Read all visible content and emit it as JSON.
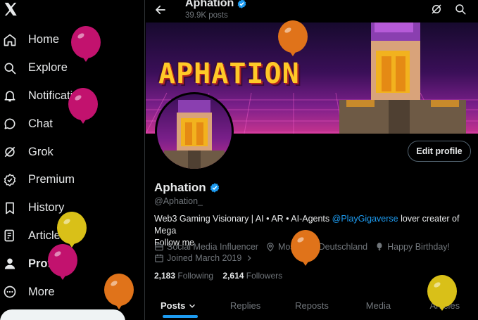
{
  "sidebar": {
    "items": [
      {
        "label": "Home",
        "icon": "home-icon"
      },
      {
        "label": "Explore",
        "icon": "search-icon"
      },
      {
        "label": "Notifications",
        "icon": "bell-icon"
      },
      {
        "label": "Chat",
        "icon": "chat-icon"
      },
      {
        "label": "Grok",
        "icon": "grok-icon"
      },
      {
        "label": "Premium",
        "icon": "premium-icon"
      },
      {
        "label": "History",
        "icon": "bookmark-icon"
      },
      {
        "label": "Articles",
        "icon": "articles-icon"
      },
      {
        "label": "Profile",
        "icon": "person-icon"
      },
      {
        "label": "More",
        "icon": "more-icon"
      }
    ]
  },
  "header": {
    "name": "Aphation",
    "post_count": "39.9K posts"
  },
  "banner": {
    "text": "APHATION"
  },
  "profile": {
    "edit_label": "Edit profile",
    "name": "Aphation",
    "handle": "@Aphation_",
    "bio_text": "Web3 Gaming Visionary | AI • AR • AI-Agents ",
    "bio_mention": "@PlayGigaverse",
    "bio_after": " lover creater of Mega",
    "bio_line2": "Follow me",
    "category": "Social Media Influencer",
    "location": "Mosbach, Deutschland",
    "birthday": "Happy Birthday!",
    "joined": "Joined March 2019",
    "following_count": "2,183",
    "following_label": "Following",
    "followers_count": "2,614",
    "followers_label": "Followers"
  },
  "tabs": [
    {
      "label": "Posts"
    },
    {
      "label": "Replies"
    },
    {
      "label": "Reposts"
    },
    {
      "label": "Media"
    },
    {
      "label": "Articles"
    }
  ],
  "colors": {
    "accent": "#1d9bf0",
    "background": "#000000",
    "balloon_magenta": "#c2126e",
    "balloon_orange": "#e0731a",
    "balloon_yellow": "#d9c018"
  }
}
